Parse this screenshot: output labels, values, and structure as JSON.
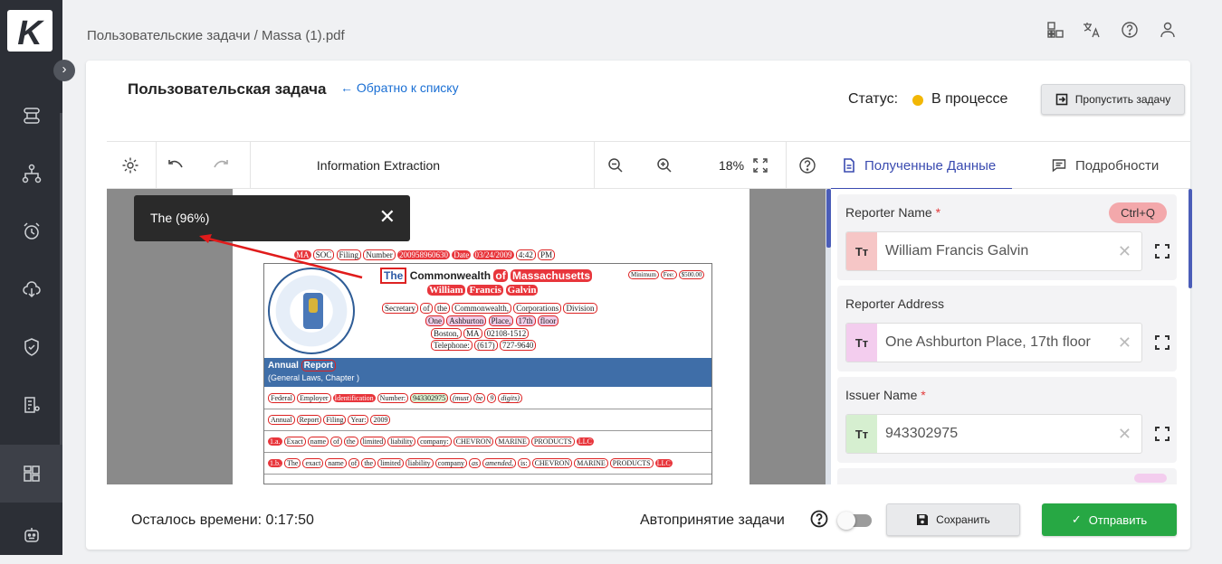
{
  "app": {
    "logo_letter": "K",
    "accent": "#3a4bb0",
    "sidebar_bg": "#2c2f36"
  },
  "sidebar": {
    "items": [
      {
        "icon": "workflow-icon"
      },
      {
        "icon": "hierarchy-icon"
      },
      {
        "icon": "alarm-clock-icon"
      },
      {
        "icon": "cloud-download-icon"
      },
      {
        "icon": "shield-check-icon"
      },
      {
        "icon": "document-list-icon"
      },
      {
        "icon": "dashboard-grid-icon",
        "active": true
      },
      {
        "icon": "robot-icon"
      }
    ]
  },
  "header": {
    "breadcrumb": "Пользовательские задачи / Massa (1).pdf",
    "icons": [
      "apps-icon",
      "translate-icon",
      "help-icon",
      "user-icon"
    ]
  },
  "task": {
    "title": "Пользовательская задача",
    "back_link": "Обратно к списку",
    "status_label": "Статус:",
    "status_value": "В процессе",
    "status_color": "#f2b705",
    "skip_button": "Пропустить задачу"
  },
  "viewer": {
    "title": "Information Extraction",
    "zoom": "18%",
    "tooltip": "The (96%)"
  },
  "document": {
    "header_line": [
      "MA",
      "SOC",
      "Filing",
      "Number",
      "200958960630",
      "Date",
      "03/24/2009",
      "4:42",
      "PM"
    ],
    "line1": [
      "The",
      "Commonwealth",
      "of",
      "Massachusetts"
    ],
    "fee": [
      "Minimum",
      "Fee:",
      "$500.00"
    ],
    "line2": [
      "William",
      "Francis",
      "Galvin"
    ],
    "line3": [
      "Secretary",
      "of",
      "the",
      "Commonwealth,",
      "Corporations",
      "Division"
    ],
    "line4": [
      "One",
      "Ashburton",
      "Place,",
      "17th",
      "floor"
    ],
    "line5": [
      "Boston,",
      "MA",
      "02108-1512"
    ],
    "line6": [
      "Telephone:",
      "(617)",
      "727-9640"
    ],
    "band_title": [
      "Annual",
      "Report"
    ],
    "band_sub": "(General Laws, Chapter )",
    "row1": [
      "Federal",
      "Employer",
      "Identification",
      "Number:",
      "943302975",
      "(must",
      "be",
      "9",
      "digits)"
    ],
    "row2": [
      "Annual",
      "Report",
      "Filing",
      "Year:",
      "2009"
    ],
    "row3": [
      "1.a.",
      "Exact",
      "name",
      "of",
      "the",
      "limited",
      "liability",
      "company:",
      "CHEVRON",
      "MARINE",
      "PRODUCTS",
      "LLC"
    ],
    "row4": [
      "1.b.",
      "The",
      "exact",
      "name",
      "of",
      "the",
      "limited",
      "liability",
      "company",
      "as",
      "amended,",
      "is:",
      "CHEVRON",
      "MARINE",
      "PRODUCTS",
      "LLC"
    ]
  },
  "panel": {
    "tabs": [
      {
        "label": "Полученные Данные",
        "icon": "document-icon",
        "active": true
      },
      {
        "label": "Подробности",
        "icon": "comment-icon",
        "active": false
      }
    ],
    "fields": [
      {
        "label": "Reporter Name",
        "required": true,
        "shortcut": "Ctrl+Q",
        "type_icon": "Tт",
        "value": "William Francis Galvin",
        "tag_color": "#f6c6c6"
      },
      {
        "label": "Reporter Address",
        "required": false,
        "shortcut": "",
        "type_icon": "Tт",
        "value": "One Ashburton Place, 17th floor",
        "tag_color": "#f3cdee"
      },
      {
        "label": "Issuer Name",
        "required": true,
        "shortcut": "",
        "type_icon": "Tт",
        "value": "943302975",
        "tag_color": "#d6efd0"
      }
    ]
  },
  "footer": {
    "time_left": "Осталось времени: 0:17:50",
    "auto_accept": "Автопринятие задачи",
    "auto_accept_on": false,
    "save_button": "Сохранить",
    "send_button": "Отправить",
    "send_color": "#27a844"
  }
}
